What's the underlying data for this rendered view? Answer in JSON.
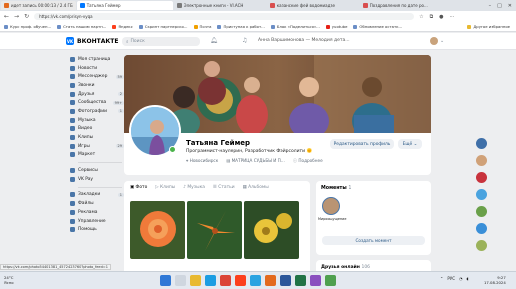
{
  "browser": {
    "tabs": [
      {
        "label": "идет запись 00:00:13 / 2.4 ГБ",
        "color": "#e36a1e"
      },
      {
        "label": "Татьяна Геймер",
        "color": "#0077ff"
      },
      {
        "label": "Электронные книги - VI.ACH",
        "color": "#7a7a7a"
      },
      {
        "label": "казанские фей водомиадзе",
        "color": "#d94f4f"
      },
      {
        "label": "Поздравления по дате ро...",
        "color": "#d94f4f"
      }
    ],
    "url": "https://vk.com/prisyn-vyqa",
    "bookmarks": [
      "Курс проф. обучен...",
      "Стать нашим партн...",
      "Яндекс",
      "Скрипт партнерско...",
      "Почта",
      "Приступая к работ...",
      "Блок «Поделиться»...",
      "yuotube",
      "Обновление остатк..."
    ],
    "bookmarks_right": "Другое избранное"
  },
  "vk": {
    "logo": "ВКОНТАКТЕ",
    "search_placeholder": "Поиск",
    "now_playing": "Анна Варшимонова — Мелодия дета...",
    "menu": [
      {
        "label": "Моя страница",
        "count": ""
      },
      {
        "label": "Новости",
        "count": ""
      },
      {
        "label": "Мессенджер",
        "count": "59"
      },
      {
        "label": "Звонки",
        "count": ""
      },
      {
        "label": "Друзья",
        "count": "2"
      },
      {
        "label": "Сообщества",
        "count": "99+"
      },
      {
        "label": "Фотографии",
        "count": "1"
      },
      {
        "label": "Музыка",
        "count": ""
      },
      {
        "label": "Видео",
        "count": ""
      },
      {
        "label": "Клипы",
        "count": ""
      },
      {
        "label": "Игры",
        "count": "29"
      },
      {
        "label": "Маркет",
        "count": ""
      }
    ],
    "menu2": [
      {
        "label": "Сервисы",
        "count": ""
      },
      {
        "label": "VK Pay",
        "count": ""
      }
    ],
    "menu3": [
      {
        "label": "Закладки",
        "count": "1"
      },
      {
        "label": "Файлы",
        "count": ""
      },
      {
        "label": "Реклама",
        "count": ""
      },
      {
        "label": "Управление",
        "count": ""
      },
      {
        "label": "Помощь",
        "count": ""
      }
    ]
  },
  "profile": {
    "name": "Татьяна Геймер",
    "status": "Программист-наулерин, Разработчик Фэйрсолити 🌞",
    "city": "Новосибирск",
    "work": "МАТРИЦА СУДЬБЫ И П...",
    "more": "Подробнее",
    "edit_button": "Редактировать профиль",
    "more_button": "Ещё"
  },
  "media": {
    "tabs": [
      "Фото",
      "Клипы",
      "Музыка",
      "Статьи",
      "Альбомы"
    ]
  },
  "moments": {
    "title": "Моменты",
    "count": "1",
    "item_name": "Мироощущение",
    "create_button": "Создать момент"
  },
  "friends": {
    "title": "Друзья онлайн",
    "count": "106"
  },
  "statusbar": {
    "hover_url": "https://vk.com/photo54401381_4572423760?photo_feed=1"
  },
  "taskbar": {
    "weather_temp": "24°C",
    "weather_text": "Ясно",
    "lang": "РУС",
    "time": "9:27",
    "date": "17.08.2024"
  }
}
